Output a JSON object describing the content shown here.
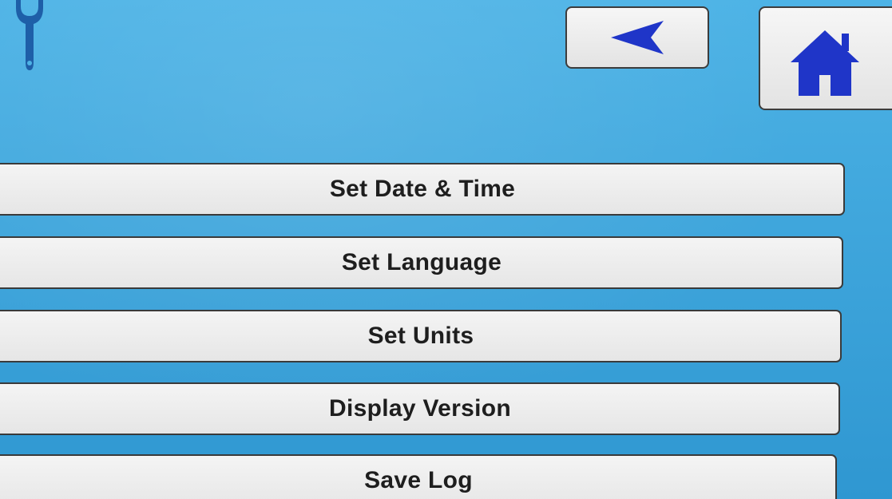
{
  "header": {
    "settings_icon": "wrench-icon",
    "back_icon": "arrow-left-icon",
    "home_icon": "home-icon"
  },
  "menu": {
    "items": [
      {
        "label": "Set Date & Time"
      },
      {
        "label": "Set Language"
      },
      {
        "label": "Set Units"
      },
      {
        "label": "Display Version"
      },
      {
        "label": "Save Log"
      }
    ]
  },
  "colors": {
    "screen_background": "#3fa6dc",
    "button_face": "#ececec",
    "icon_blue": "#1f35c8",
    "wrench_blue": "#1e5fa8",
    "text": "#1e1e1e"
  }
}
